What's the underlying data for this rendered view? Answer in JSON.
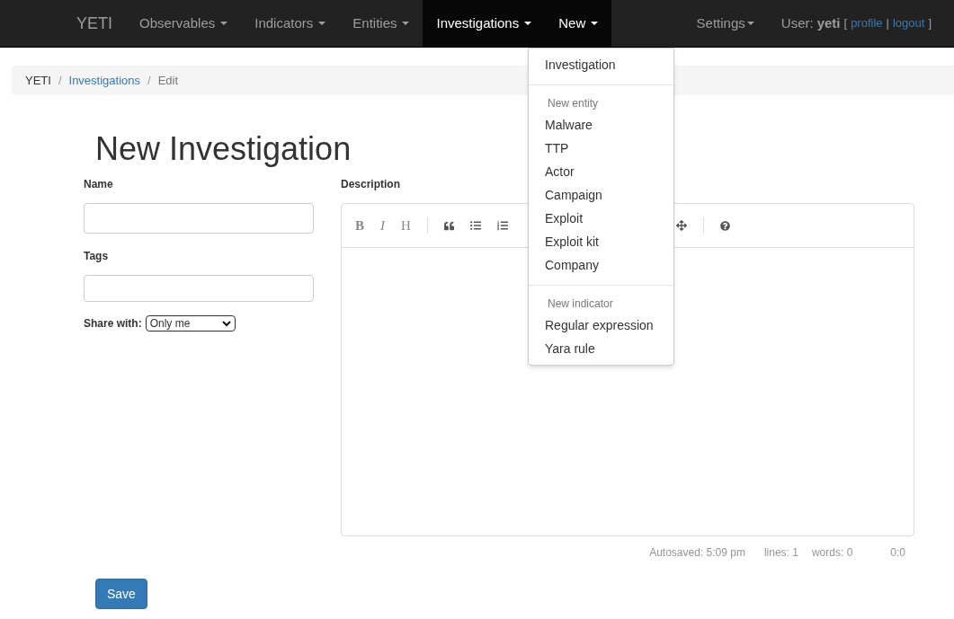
{
  "navbar": {
    "brand": "YETI",
    "items": [
      {
        "label": "Observables",
        "selected": false
      },
      {
        "label": "Indicators",
        "selected": false
      },
      {
        "label": "Entities",
        "selected": false
      },
      {
        "label": "Investigations",
        "selected": true
      },
      {
        "label": "New",
        "selected": true
      }
    ],
    "settings": "Settings",
    "user_label": "User:",
    "user": "yeti",
    "bracket_open": "[",
    "profile": "profile",
    "link_separator": "|",
    "logout": "logout",
    "bracket_close": "]"
  },
  "breadcrumb_separator": "/",
  "dropdown": {
    "items": [
      {
        "kind": "item",
        "label": "Investigation"
      },
      {
        "kind": "divider"
      },
      {
        "kind": "header",
        "label": "New entity"
      },
      {
        "kind": "item",
        "label": "Malware"
      },
      {
        "kind": "item",
        "label": "TTP"
      },
      {
        "kind": "item",
        "label": "Actor"
      },
      {
        "kind": "item",
        "label": "Campaign"
      },
      {
        "kind": "item",
        "label": "Exploit"
      },
      {
        "kind": "item",
        "label": "Exploit kit"
      },
      {
        "kind": "item",
        "label": "Company"
      },
      {
        "kind": "divider"
      },
      {
        "kind": "header",
        "label": "New indicator"
      },
      {
        "kind": "item",
        "label": "Regular expression"
      },
      {
        "kind": "item",
        "label": "Yara rule"
      }
    ]
  },
  "breadcrumb": [
    {
      "label": "YETI",
      "kind": "text"
    },
    {
      "label": "Investigations",
      "kind": "link"
    },
    {
      "label": "Edit",
      "kind": "current"
    }
  ],
  "title": "New Investigation",
  "form": {
    "name_label": "Name",
    "tags_label": "Tags",
    "share_label": "Share with:",
    "share_value": "Only me",
    "description_label": "Description"
  },
  "editor": {
    "toolbar": [
      "B",
      "I",
      "H"
    ],
    "status": [
      "Autosaved: 5:09 pm",
      "lines: 1",
      "words: 0",
      "0:0"
    ]
  },
  "save": "Save"
}
